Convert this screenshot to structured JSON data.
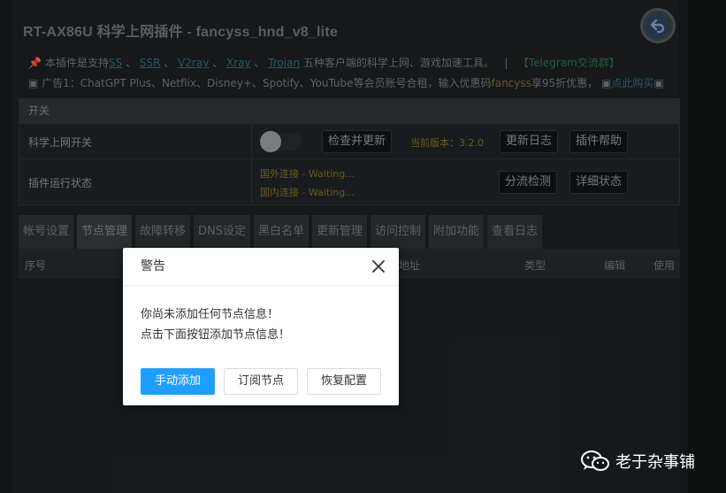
{
  "header": {
    "title": "RT-AX86U 科学上网插件 - fancyss_hnd_v8_lite",
    "back_icon": "back-arrow-icon"
  },
  "info": {
    "line1_prefix": "本插件是支持",
    "protocols": [
      "SS",
      "SSR",
      "V2ray",
      "Xray",
      "Trojan"
    ],
    "line1_suffix": "五种客户端的科学上网、游戏加速工具。",
    "divider": "|",
    "telegram": "【Telegram交流群】",
    "line2_prefix": "广告1：ChatGPT Plus、Netflix、Disney+、Spotify、YouTube等会员账号合租，输入优惠码",
    "promo_code": "fancyss",
    "line2_mid": "享95折优惠，",
    "buy_link": "点此购买"
  },
  "panel": {
    "head": "开关",
    "switch_label": "科学上网开关",
    "check_update": "检查并更新",
    "version": "当前版本：3.2.0",
    "changelog": "更新日志",
    "help": "插件帮助",
    "status_label": "插件运行状态",
    "foreign": "国外连接 - Waiting...",
    "domestic": "国内连接 - Waiting...",
    "routing_check": "分流检测",
    "detail_status": "详细状态"
  },
  "tabs": [
    "帐号设置",
    "节点管理",
    "故障转移",
    "DNS设定",
    "黑白名单",
    "更新管理",
    "访问控制",
    "附加功能",
    "查看日志"
  ],
  "table": {
    "col_index": "序号",
    "col_address": "地址",
    "col_type": "类型",
    "col_edit": "编辑",
    "col_use": "使用"
  },
  "dialog": {
    "title": "警告",
    "line1": "你尚未添加任何节点信息！",
    "line2": "点击下面按钮添加节点信息！",
    "btn_manual": "手动添加",
    "btn_subscribe": "订阅节点",
    "btn_restore": "恢复配置"
  },
  "watermark": {
    "text": "老于杂事铺"
  },
  "colors": {
    "primary_button": "#1e9fff",
    "version_text": "#7a6a2a",
    "link": "#2f6a73"
  }
}
